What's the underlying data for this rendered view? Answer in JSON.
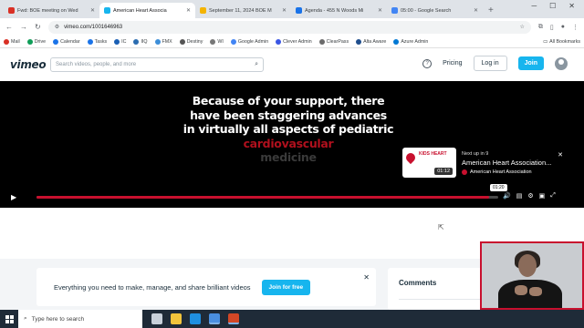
{
  "browser": {
    "tabs": [
      {
        "title": "Fwd: BOE meeting on Wed",
        "favicon_color": "#d93025",
        "active": false
      },
      {
        "title": "American Heart Associa",
        "favicon_color": "#17b5ee",
        "active": true
      },
      {
        "title": "September 11, 2024 BOE M",
        "favicon_color": "#f4b400",
        "active": false
      },
      {
        "title": "Agenda - 455 N Woods Mi",
        "favicon_color": "#1a73e8",
        "active": false
      },
      {
        "title": "05:00 - Google Search",
        "favicon_color": "#4285f4",
        "active": false
      }
    ],
    "url": "vimeo.com/1001646963",
    "bookmarks": [
      {
        "label": "Mail",
        "color": "#d93025"
      },
      {
        "label": "Drive",
        "color": "#0f9d58"
      },
      {
        "label": "Calendar",
        "color": "#1a73e8"
      },
      {
        "label": "Tasks",
        "color": "#1a73e8"
      },
      {
        "label": "IC",
        "color": "#1a5fb4"
      },
      {
        "label": "IIQ",
        "color": "#2b6cb0"
      },
      {
        "label": "FMX",
        "color": "#3d8ed8"
      },
      {
        "label": "Destiny",
        "color": "#555555"
      },
      {
        "label": "WI",
        "color": "#777777"
      },
      {
        "label": "Google Admin",
        "color": "#4285f4"
      },
      {
        "label": "Clever Admin",
        "color": "#3a56e4"
      },
      {
        "label": "ClearPass",
        "color": "#6b6b6b"
      },
      {
        "label": "Alta Aware",
        "color": "#1f4e8c"
      },
      {
        "label": "Azure Admin",
        "color": "#0078d4"
      }
    ],
    "all_bookmarks": "All Bookmarks"
  },
  "vimeo": {
    "logo": "vimeo",
    "search_placeholder": "Search videos, people, and more",
    "pricing": "Pricing",
    "login": "Log in",
    "join": "Join"
  },
  "player": {
    "caption_white": "Because of your support, there have been staggering advances in virtually all aspects of pediatric",
    "caption_red": "cardiovascular",
    "caption_grey": "medicine",
    "up_next": {
      "label": "Next up in 9",
      "title": "American Heart Association...",
      "channel": "American Heart Association",
      "thumb_text": "KIDS HEART",
      "duration": "01:12"
    },
    "progress": 0.98,
    "time_bubble": "01:20"
  },
  "page": {
    "promo_text": "Everything you need to make, manage, and share brilliant videos",
    "join_free": "Join for free",
    "comments_title": "Comments"
  },
  "taskbar": {
    "search_placeholder": "Type here to search",
    "apps": [
      {
        "name": "task-view",
        "color": "#c8d0da"
      },
      {
        "name": "file-explorer",
        "color": "#f2c43c"
      },
      {
        "name": "edge",
        "color": "#1f8fe0"
      },
      {
        "name": "chrome",
        "color": "#4a8fe0",
        "active": true
      },
      {
        "name": "powerpoint",
        "color": "#d24726",
        "active": true
      }
    ]
  }
}
